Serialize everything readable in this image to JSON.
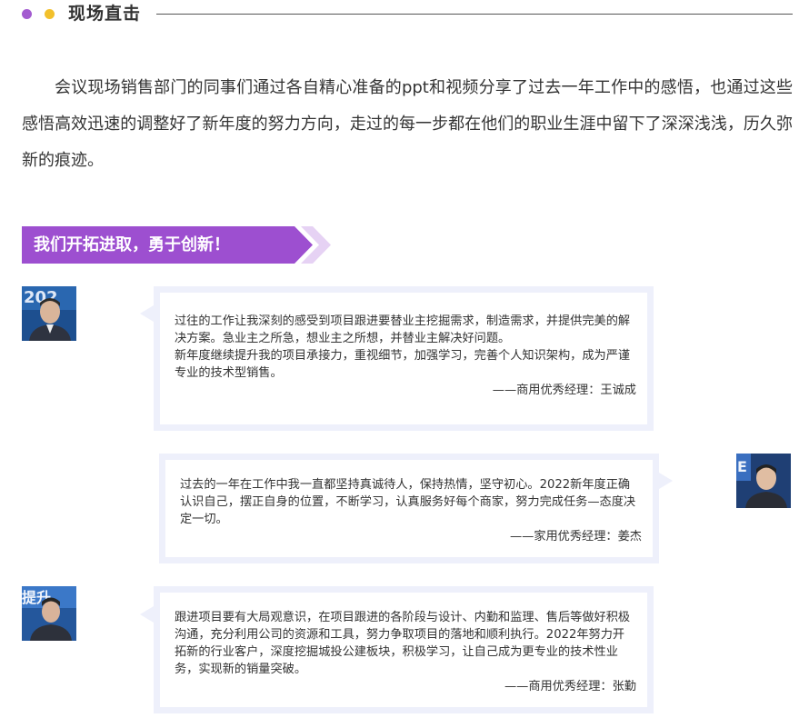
{
  "section": {
    "title": "现场直击"
  },
  "intro": "会议现场销售部门的同事们通过各自精心准备的ppt和视频分享了过去一年工作中的感悟，也通过这些感悟高效迅速的调整好了新年度的努力方向，走过的每一步都在他们的职业生涯中留下了深深浅浅，历久弥新的痕迹。",
  "banner": {
    "text": "我们开拓进取，勇于创新！"
  },
  "testimonials": [
    {
      "paragraphs": [
        "过往的工作让我深刻的感受到项目跟进要替业主挖掘需求，制造需求，并提供完美的解决方案。急业主之所急，想业主之所想，并替业主解决好问题。",
        "新年度继续提升我的项目承接力，重视细节，加强学习，完善个人知识架构，成为严谨专业的技术型销售。"
      ],
      "signature": "——商用优秀经理：王诚成",
      "avatar_bg_text": "202"
    },
    {
      "paragraphs": [
        "过去的一年在工作中我一直都坚持真诚待人，保持热情，坚守初心。2022新年度正确认识自己，摆正自身的位置，不断学习，认真服务好每个商家，努力完成任务—态度决定一切。"
      ],
      "signature": "——家用优秀经理：姜杰",
      "avatar_bg_text": "E"
    },
    {
      "paragraphs": [
        "跟进项目要有大局观意识，在项目跟进的各阶段与设计、内勤和监理、售后等做好积极沟通，充分利用公司的资源和工具，努力争取项目的落地和顺利执行。2022年努力开拓新的行业客户，深度挖掘城投公建板块，积极学习，让自己成为更专业的技术性业务，实现新的销量突破。"
      ],
      "signature": "——商用优秀经理：张勤",
      "avatar_bg_text": "提升"
    }
  ],
  "colors": {
    "accent": "#9d4fd0",
    "dot_yellow": "#f2c02c",
    "card_border": "#eef0fb"
  }
}
